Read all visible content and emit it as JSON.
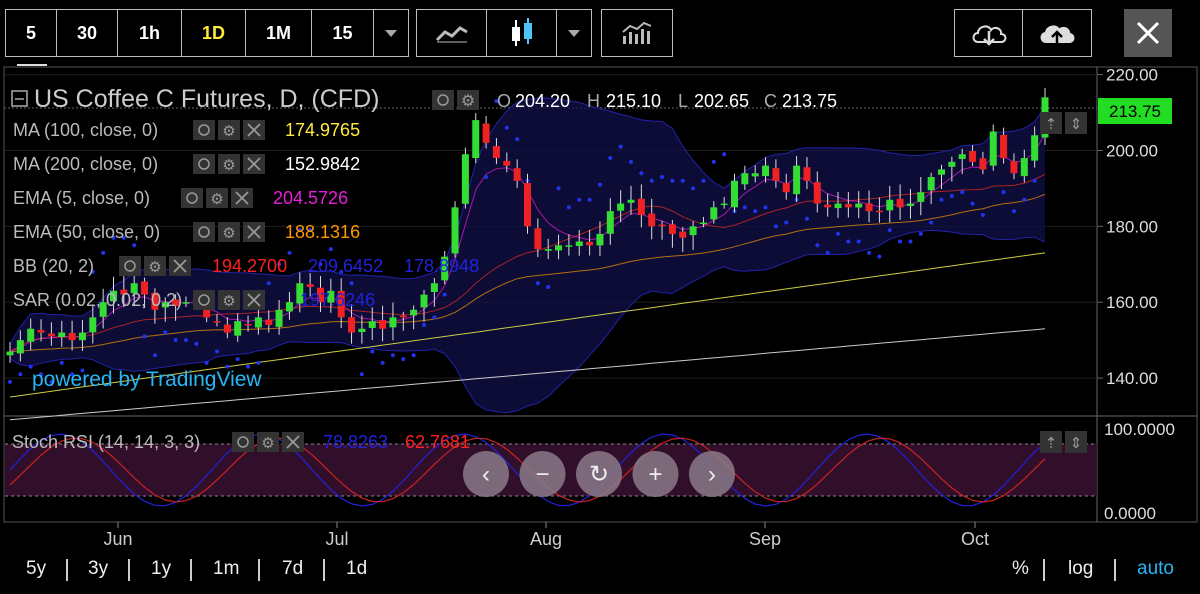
{
  "toolbar": {
    "intervals": [
      "5",
      "30",
      "1h",
      "1D",
      "1M",
      "15"
    ],
    "active_interval": "1D"
  },
  "chart": {
    "title": "US Coffee C Futures, D, (CFD)",
    "ohlc": {
      "o_label": "O",
      "o": "204.20",
      "h_label": "H",
      "h": "215.10",
      "l_label": "L",
      "l": "202.65",
      "c_label": "C",
      "c": "213.75"
    },
    "last_price": "213.75",
    "watermark": "powered by TradingView",
    "indicators": [
      {
        "name": "MA (100, close, 0)",
        "value": "174.9765",
        "color": "#ffeb3b"
      },
      {
        "name": "MA (200, close, 0)",
        "value": "152.9842",
        "color": "#ffffff"
      },
      {
        "name": "EMA (5, close, 0)",
        "value": "204.5726",
        "color": "#e91edc"
      },
      {
        "name": "EMA (50, close, 0)",
        "value": "188.1316",
        "color": "#ff9800"
      },
      {
        "name": "BB (20, 2)",
        "values": [
          "194.2700",
          "209.6452",
          "178.8948"
        ],
        "colors": [
          "#ff2020",
          "#2222dd",
          "#2222dd"
        ]
      },
      {
        "name": "SAR (0.02, 0.02, 0.2)",
        "value": "197.6246",
        "color": "#2222dd"
      }
    ],
    "stoch": {
      "name": "Stoch RSI (14, 14, 3, 3)",
      "k": "78.8263",
      "d": "62.7681",
      "k_color": "#2222dd",
      "d_color": "#ff2020"
    },
    "price_axis": [
      "220.00",
      "200.00",
      "180.00",
      "160.00",
      "140.00"
    ],
    "stoch_axis": [
      "100.0000",
      "0.0000"
    ],
    "time_axis": [
      "Jun",
      "Jul",
      "Aug",
      "Sep",
      "Oct"
    ]
  },
  "chart_data": {
    "type": "candlestick",
    "ylim": [
      130,
      222
    ],
    "x": [
      "May 22",
      "May 23",
      "May 24",
      "May 27",
      "May 28",
      "May 29",
      "May 30",
      "May 31",
      "Jun 3",
      "Jun 4",
      "Jun 5",
      "Jun 6",
      "Jun 7",
      "Jun 10",
      "Jun 11",
      "Jun 12",
      "Jun 13",
      "Jun 14",
      "Jun 17",
      "Jun 18",
      "Jun 19",
      "Jun 20",
      "Jun 21",
      "Jun 24",
      "Jun 25",
      "Jun 26",
      "Jun 27",
      "Jun 28",
      "Jul 1",
      "Jul 2",
      "Jul 3",
      "Jul 5",
      "Jul 8",
      "Jul 9",
      "Jul 10",
      "Jul 11",
      "Jul 12",
      "Jul 15",
      "Jul 16",
      "Jul 17",
      "Jul 18",
      "Jul 19",
      "Jul 22",
      "Jul 23",
      "Jul 24",
      "Jul 25",
      "Jul 26",
      "Jul 29",
      "Jul 30",
      "Jul 31",
      "Aug 1",
      "Aug 2",
      "Aug 5",
      "Aug 6",
      "Aug 7",
      "Aug 8",
      "Aug 9",
      "Aug 12",
      "Aug 13",
      "Aug 14",
      "Aug 15",
      "Aug 16",
      "Aug 19",
      "Aug 20",
      "Aug 21",
      "Aug 22",
      "Aug 23",
      "Aug 26",
      "Aug 27",
      "Aug 28",
      "Aug 29",
      "Aug 30",
      "Sep 3",
      "Sep 4",
      "Sep 5",
      "Sep 6",
      "Sep 9",
      "Sep 10",
      "Sep 11",
      "Sep 12",
      "Sep 13",
      "Sep 16",
      "Sep 17",
      "Sep 18",
      "Sep 19",
      "Sep 20",
      "Sep 23",
      "Sep 24",
      "Sep 25",
      "Sep 26",
      "Sep 27",
      "Sep 30",
      "Oct 1",
      "Oct 2",
      "Oct 3",
      "Oct 4",
      "Oct 7",
      "Oct 8",
      "Oct 9",
      "Oct 10",
      "Oct 11"
    ],
    "close": [
      147,
      150,
      153,
      152,
      151,
      152,
      150,
      152,
      156,
      160,
      163,
      162,
      165,
      162,
      158,
      160,
      159,
      160,
      160,
      156,
      155,
      152,
      155,
      154,
      156,
      154,
      158,
      160,
      165,
      164,
      160,
      163,
      156,
      152,
      153,
      155,
      153,
      156,
      156,
      158,
      162,
      165,
      172,
      185,
      199,
      208,
      202,
      198,
      196,
      192,
      180,
      174,
      174,
      175,
      175,
      176,
      175,
      178,
      184,
      186,
      187,
      183,
      180,
      180,
      178,
      177,
      180,
      181,
      185,
      186,
      192,
      194,
      194,
      196,
      192,
      189,
      196,
      192,
      186,
      185,
      186,
      185,
      186,
      184,
      184,
      187,
      185,
      186,
      189,
      193,
      195,
      197,
      199,
      197,
      195,
      205,
      198,
      194,
      198,
      204,
      214
    ],
    "series": [
      {
        "name": "MA (100, close, 0)",
        "last": 174.9765
      },
      {
        "name": "MA (200, close, 0)",
        "last": 152.9842
      },
      {
        "name": "EMA (5, close, 0)",
        "last": 204.5726
      },
      {
        "name": "EMA (50, close, 0)",
        "last": 188.1316
      },
      {
        "name": "BB (20, 2)",
        "last": [
          194.27,
          209.6452,
          178.8948
        ]
      },
      {
        "name": "SAR (0.02, 0.02, 0.2)",
        "last": 197.6246
      },
      {
        "name": "Stoch RSI K",
        "last": 78.8263
      },
      {
        "name": "Stoch RSI D",
        "last": 62.7681
      }
    ]
  },
  "navigation": {
    "buttons": [
      "‹",
      "−",
      "↻",
      "+",
      "›"
    ]
  },
  "bottom": {
    "ranges": [
      "5y",
      "3y",
      "1y",
      "1m",
      "7d",
      "1d"
    ],
    "percent": "%",
    "log": "log",
    "auto": "auto"
  },
  "colors": {
    "up": "#33dd33",
    "down": "#ee2222",
    "accent": "#ffeb3b",
    "price_tag": "#22dd22"
  }
}
